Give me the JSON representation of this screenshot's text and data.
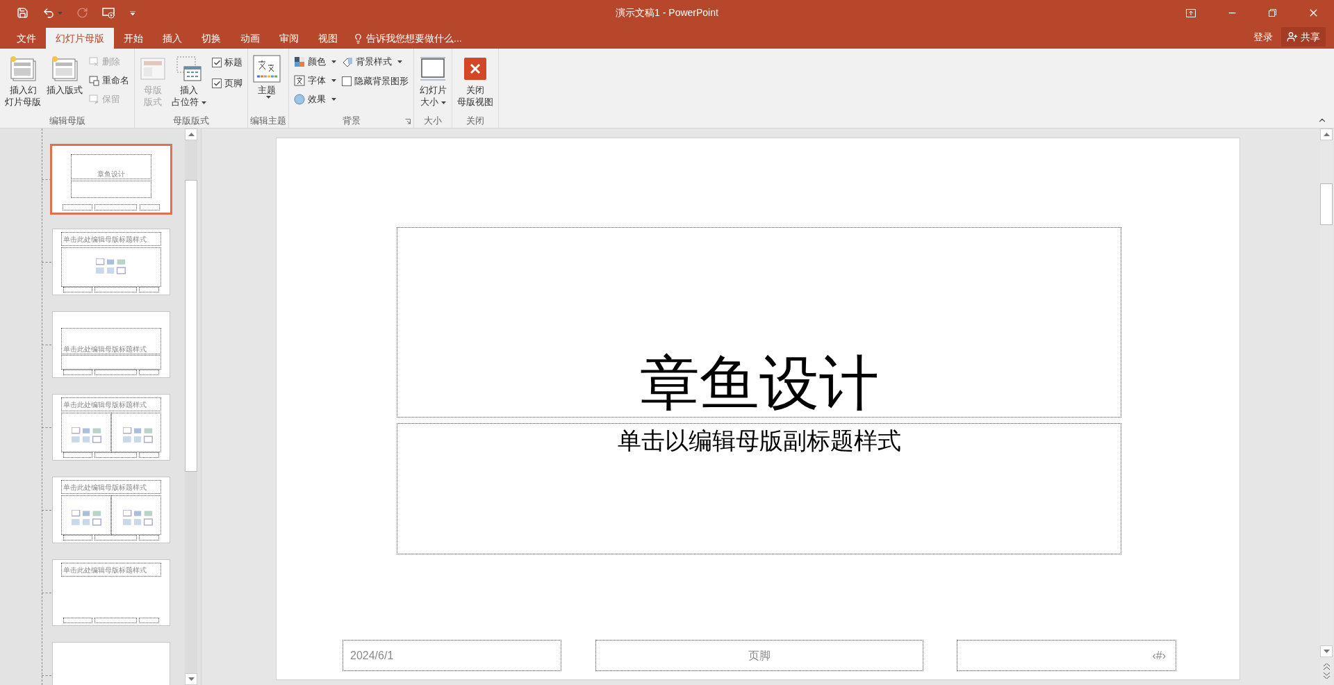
{
  "window": {
    "title": "演示文稿1 - PowerPoint"
  },
  "tabs": [
    {
      "label": "文件",
      "selected": false
    },
    {
      "label": "幻灯片母版",
      "selected": true
    },
    {
      "label": "开始",
      "selected": false
    },
    {
      "label": "插入",
      "selected": false
    },
    {
      "label": "切换",
      "selected": false
    },
    {
      "label": "动画",
      "selected": false
    },
    {
      "label": "审阅",
      "selected": false
    },
    {
      "label": "视图",
      "selected": false
    }
  ],
  "tell_me": "告诉我您想要做什么...",
  "account": {
    "sign_in": "登录",
    "share": "共享"
  },
  "ribbon": {
    "groups": [
      {
        "label": "编辑母版",
        "columns": [
          {
            "items": [
              {
                "kind": "large",
                "lines": [
                  "插入幻",
                  "灯片母版"
                ],
                "disabled": false,
                "dropdown": false
              }
            ]
          },
          {
            "items": [
              {
                "kind": "large",
                "lines": [
                  "插入版式"
                ],
                "disabled": false,
                "dropdown": false
              }
            ]
          },
          {
            "items": [
              {
                "kind": "small",
                "label": "删除",
                "disabled": true,
                "dropdown": false
              },
              {
                "kind": "small",
                "label": "重命名",
                "disabled": false,
                "dropdown": false
              },
              {
                "kind": "small",
                "label": "保留",
                "disabled": true,
                "dropdown": false
              }
            ]
          }
        ]
      },
      {
        "label": "母版版式",
        "columns": [
          {
            "items": [
              {
                "kind": "large",
                "lines": [
                  "母版",
                  "版式"
                ],
                "disabled": true,
                "dropdown": false
              }
            ]
          },
          {
            "items": [
              {
                "kind": "large",
                "lines": [
                  "插入",
                  "占位符"
                ],
                "disabled": false,
                "dropdown": true
              }
            ]
          },
          {
            "items": [
              {
                "kind": "check",
                "label": "标题",
                "checked": true
              },
              {
                "kind": "check",
                "label": "页脚",
                "checked": true
              }
            ]
          }
        ]
      },
      {
        "label": "编辑主题",
        "columns": [
          {
            "items": [
              {
                "kind": "large",
                "lines": [
                  "主题"
                ],
                "disabled": false,
                "dropdown": true
              }
            ]
          }
        ]
      },
      {
        "label": "背景",
        "launcher": true,
        "columns": [
          {
            "items": [
              {
                "kind": "small",
                "label": "颜色",
                "disabled": false,
                "dropdown": true
              },
              {
                "kind": "small",
                "label": "字体",
                "disabled": false,
                "dropdown": true
              },
              {
                "kind": "small",
                "label": "效果",
                "disabled": false,
                "dropdown": true
              }
            ]
          },
          {
            "items": [
              {
                "kind": "small",
                "label": "背景样式",
                "disabled": false,
                "dropdown": true
              },
              {
                "kind": "check",
                "label": "隐藏背景图形",
                "checked": false
              }
            ]
          }
        ]
      },
      {
        "label": "大小",
        "columns": [
          {
            "items": [
              {
                "kind": "large",
                "lines": [
                  "幻灯片",
                  "大小"
                ],
                "disabled": false,
                "dropdown": true
              }
            ]
          }
        ]
      },
      {
        "label": "关闭",
        "columns": [
          {
            "items": [
              {
                "kind": "large",
                "lines": [
                  "关闭",
                  "母版视图"
                ],
                "disabled": false,
                "dropdown": false
              }
            ]
          }
        ]
      }
    ]
  },
  "thumbnails": [
    {
      "kind": "title",
      "title": "章鱼设计",
      "selected": true
    },
    {
      "kind": "content",
      "title": "单击此处编辑母版标题样式",
      "selected": false
    },
    {
      "kind": "section",
      "title": "单击此处编辑母版标题样式",
      "selected": false
    },
    {
      "kind": "two",
      "title": "单击此处编辑母版标题样式",
      "selected": false
    },
    {
      "kind": "compare",
      "title": "单击此处编辑母版标题样式",
      "selected": false
    },
    {
      "kind": "title_only",
      "title": "单击此处编辑母版标题样式",
      "selected": false
    },
    {
      "kind": "blank",
      "selected": false
    }
  ],
  "slide": {
    "title": "章鱼设计",
    "subtitle": "单击以编辑母版副标题样式",
    "date": "2024/6/1",
    "footer": "页脚",
    "number": "‹#›"
  }
}
